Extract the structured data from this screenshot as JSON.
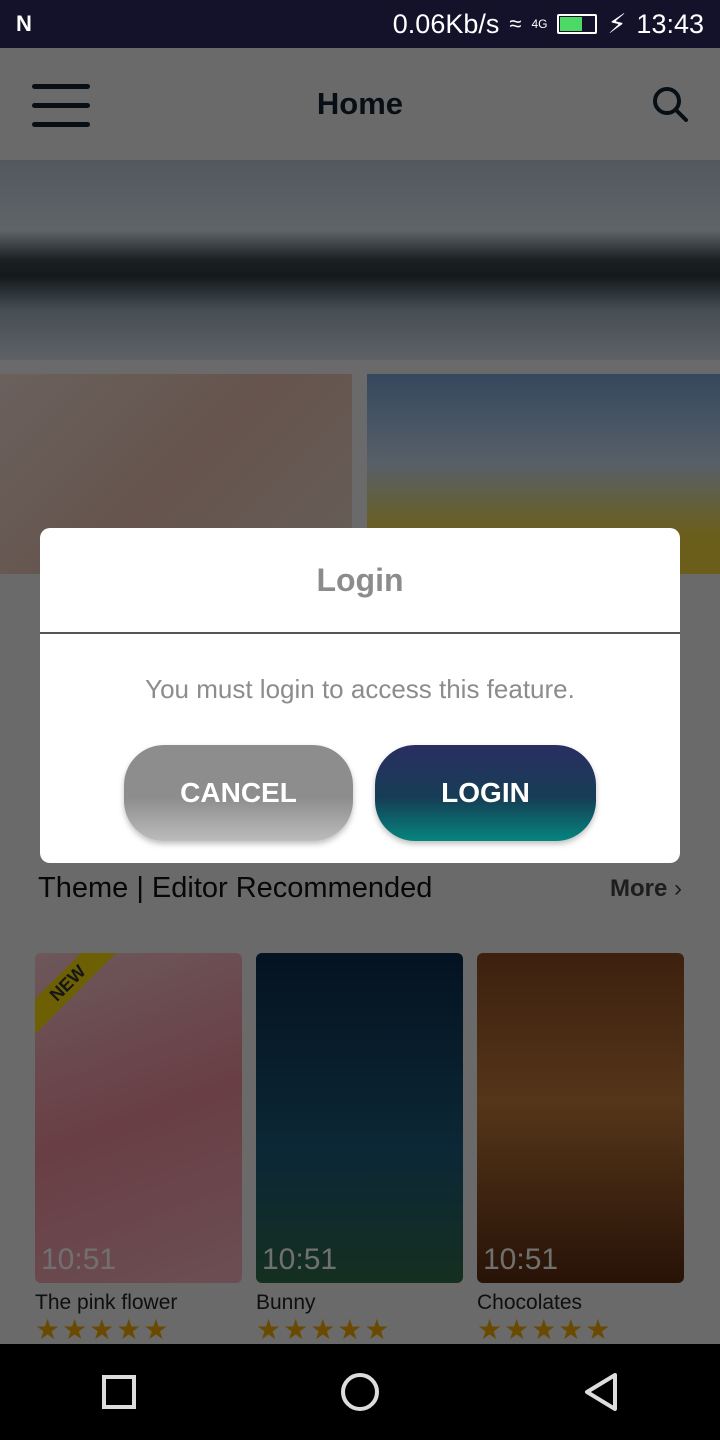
{
  "status_bar": {
    "net_speed": "0.06Kb/s",
    "network": "4G",
    "time": "13:43",
    "battery_level": 0.6,
    "icons": [
      "n-icon",
      "wifi-icon",
      "signal-icon",
      "battery-icon",
      "charging-icon"
    ]
  },
  "app_bar": {
    "title": "Home",
    "icons": [
      "menu-icon",
      "search-icon"
    ]
  },
  "section": {
    "title": "Theme | Editor Recommended",
    "more": "More"
  },
  "themes": [
    {
      "name": "The pink flower",
      "clock": "10:51",
      "badge": "NEW",
      "rating": 5
    },
    {
      "name": "Bunny",
      "clock": "10:51",
      "rating": 5
    },
    {
      "name": "Chocolates",
      "clock": "10:51",
      "rating": 5
    }
  ],
  "dialog": {
    "title": "Login",
    "message": "You must login to access this feature.",
    "cancel": "CANCEL",
    "login": "LOGIN"
  },
  "colors": {
    "status_bar": "#13122a",
    "login_top": "#2a2e62",
    "login_bottom": "#05857e",
    "cancel": "#8d8d8d",
    "stars": "#f2a900"
  }
}
